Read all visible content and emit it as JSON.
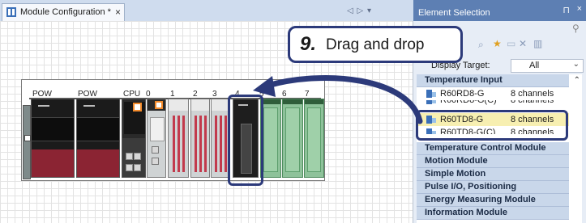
{
  "editor_tab": {
    "label": "Module Configuration *",
    "close": "×",
    "icon": "module-config-icon"
  },
  "base_unit": {
    "slot_labels": [
      "POW",
      "POW",
      "CPU",
      "0",
      "1",
      "2",
      "3",
      "4",
      "5",
      "6",
      "7"
    ]
  },
  "callout": {
    "step": "9.",
    "text": "Drag and drop"
  },
  "panel": {
    "nav": "◁ ▷ ▾",
    "title": "Element Selection",
    "pin": "⊓",
    "close": "×",
    "filter_label": "Display Target:",
    "filter_value": "All",
    "categories": {
      "temperature_input": "Temperature Input",
      "temperature_control": "Temperature Control Module",
      "motion": "Motion Module",
      "simple_motion": "Simple Motion",
      "pulse_io": "Pulse I/O, Positioning",
      "energy": "Energy Measuring Module",
      "information": "Information Module"
    },
    "items": [
      {
        "model": "R60RD8-G",
        "channels": "8 channels"
      },
      {
        "model": "R60RD8-G(C)",
        "channels": "8 channels"
      },
      {
        "model": "R60TD8-G",
        "channels": "8 channels"
      },
      {
        "model": "R60TD8-G(C)",
        "channels": "8 channels"
      }
    ]
  },
  "colors": {
    "accent": "#2c3a7a",
    "panel_header": "#5d7fb3",
    "category_bg": "#c9d7ea",
    "selected_item": "#f7efb1"
  }
}
